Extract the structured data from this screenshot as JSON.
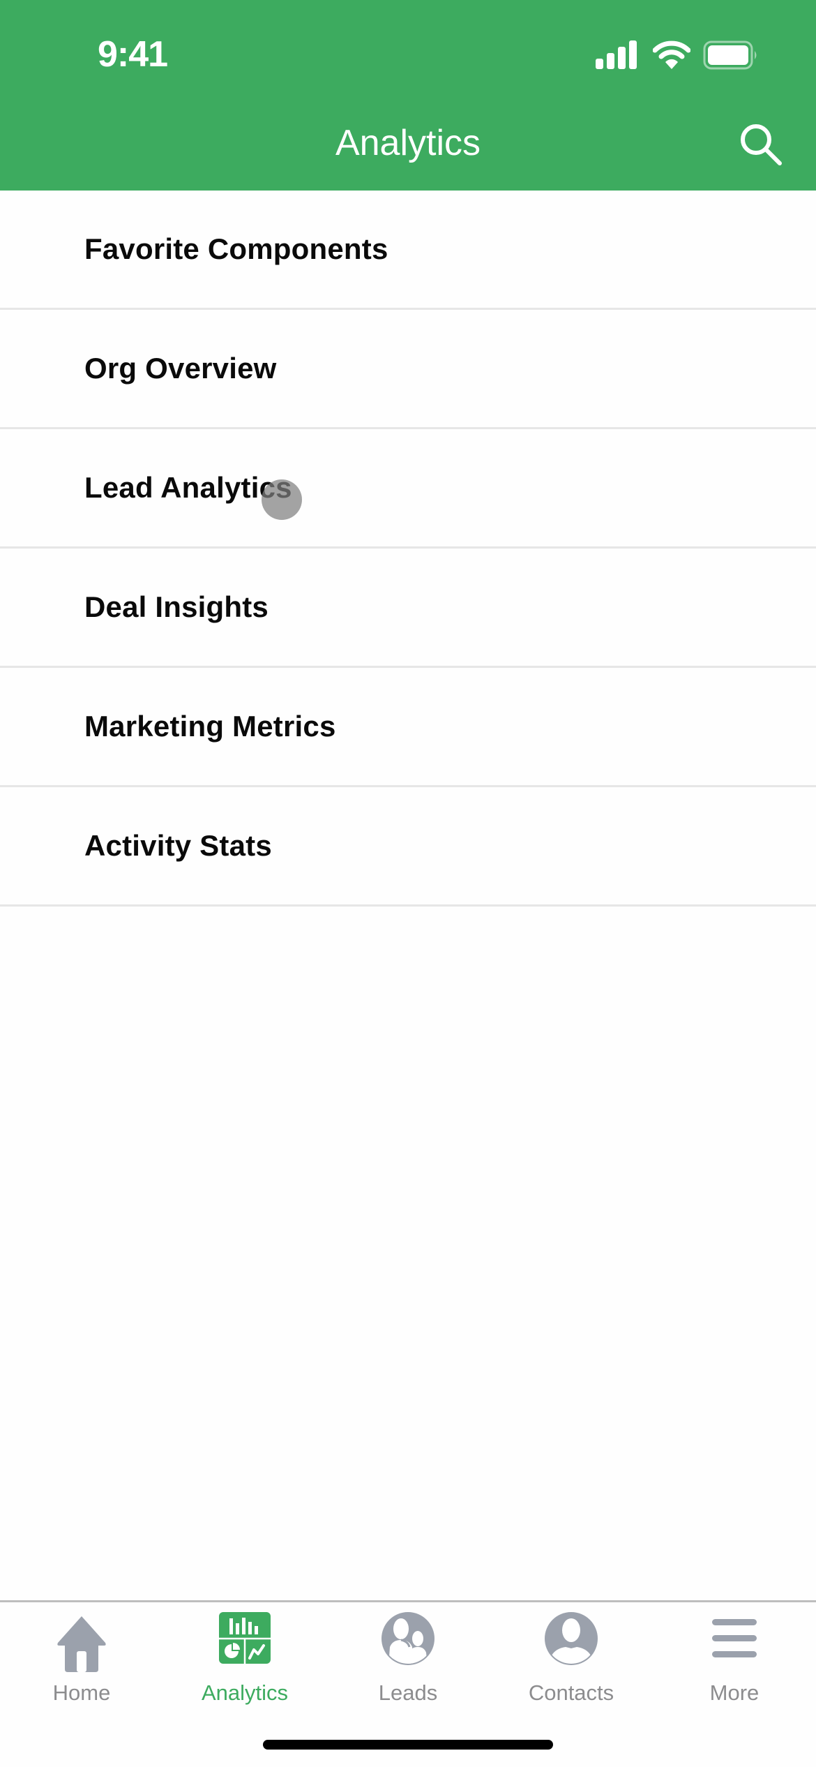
{
  "status_bar": {
    "time": "9:41",
    "icons": [
      "cellular-signal-icon",
      "wifi-icon",
      "battery-icon"
    ]
  },
  "nav_bar": {
    "title": "Analytics",
    "right_action": {
      "icon": "search-icon",
      "label": "Search"
    }
  },
  "colors": {
    "brand_green": "#3DAB5F",
    "tab_inactive": "#9BA1AC",
    "tab_label_inactive": "#8C8C8E",
    "separator": "#E6E6E6"
  },
  "list": {
    "items": [
      {
        "label": "Favorite Components"
      },
      {
        "label": "Org Overview"
      },
      {
        "label": "Lead Analytics"
      },
      {
        "label": "Deal Insights"
      },
      {
        "label": "Marketing Metrics"
      },
      {
        "label": "Activity Stats"
      }
    ]
  },
  "tab_bar": {
    "active": "Analytics",
    "tabs": [
      {
        "label": "Home",
        "icon": "home-icon"
      },
      {
        "label": "Analytics",
        "icon": "analytics-icon"
      },
      {
        "label": "Leads",
        "icon": "leads-icon"
      },
      {
        "label": "Contacts",
        "icon": "contacts-icon"
      },
      {
        "label": "More",
        "icon": "menu-icon"
      }
    ]
  }
}
